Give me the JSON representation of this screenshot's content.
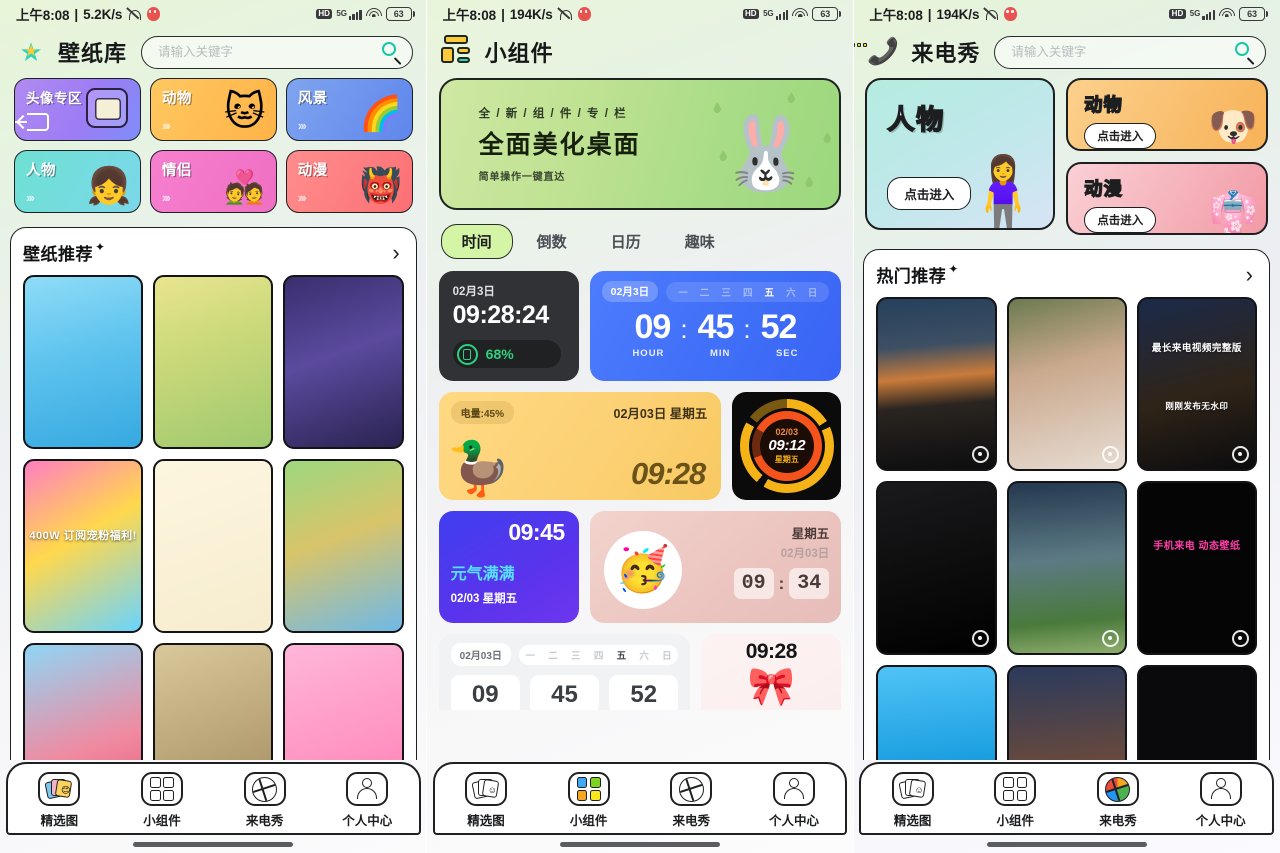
{
  "statusbar": {
    "time": "上午8:08",
    "sep": "|",
    "speed_p1": "5.2K/s",
    "speed_p2": "194K/s",
    "speed_p3": "194K/s",
    "hd_label": "HD",
    "network_label": "5G",
    "battery_level": "63",
    "icons": [
      "mute-icon",
      "qq-icon",
      "hd-icon",
      "5g-signal-icon",
      "wifi-icon",
      "battery-icon"
    ]
  },
  "panel1": {
    "app_title": "壁纸库",
    "logo_icon": "star-logo-icon",
    "search_placeholder": "请输入关键字",
    "search_value": "",
    "search_icon": "search-icon",
    "categories": [
      {
        "name": "头像专区",
        "chev": "",
        "style": "cat-avatar",
        "wide": true
      },
      {
        "name": "动物",
        "chev": "›››",
        "style": "cat-animal"
      },
      {
        "name": "风景",
        "chev": "›››",
        "style": "cat-scenery"
      },
      {
        "name": "人物",
        "chev": "›››",
        "style": "cat-person"
      },
      {
        "name": "情侣",
        "chev": "›››",
        "style": "cat-couple"
      },
      {
        "name": "动漫",
        "chev": "›››",
        "style": "cat-anime"
      }
    ],
    "section_title": "壁纸推荐",
    "section_sparkle": "✦",
    "section_arrow": "›",
    "thumbs": [
      {
        "caption": "",
        "bg": "linear-gradient(165deg,#8fdcf7,#5ec3ee 45%,#36a9e0)"
      },
      {
        "caption": "",
        "bg": "linear-gradient(160deg,#e9e58f,#cbd97a 40%,#9fc96e)"
      },
      {
        "caption": "",
        "bg": "linear-gradient(160deg,#3a2e6e,#5b4a9e 45%,#2a2350)"
      },
      {
        "caption": "400W 订阅宠粉福利!",
        "bg": "linear-gradient(150deg,#ff7ec1,#ffd84d 45%,#6ad4ff)"
      },
      {
        "caption": "",
        "bg": "linear-gradient(160deg,#fdf6e0,#f6ecce)"
      },
      {
        "caption": "",
        "bg": "linear-gradient(160deg,#9cd87f,#d8c46a 45%,#6fb9e8)"
      },
      {
        "caption": "",
        "bg": "linear-gradient(160deg,#8fd6f5,#f08aa0 60%,#e55a7a)"
      },
      {
        "caption": "",
        "bg": "linear-gradient(160deg,#d8c89a,#a38b5e)"
      },
      {
        "caption": "",
        "bg": "linear-gradient(160deg,#ffb6d9,#ff7fb3)"
      }
    ]
  },
  "panel2": {
    "app_title": "小组件",
    "logo_icon": "widget-grid-logo-icon",
    "banner": {
      "sub1": "全 / 新 / 组 / 件 / 专 / 栏",
      "big": "全面美化桌面",
      "sub2": "简单操作一键直达",
      "mascot_icon": "bunny-with-leaf-icon"
    },
    "tabs": [
      {
        "label": "时间",
        "active": true
      },
      {
        "label": "倒数",
        "active": false
      },
      {
        "label": "日历",
        "active": false
      },
      {
        "label": "趣味",
        "active": false
      }
    ],
    "widgets": {
      "dark_clock": {
        "date": "02月3日",
        "time": "09:28:24",
        "battery": "68%",
        "battery_icon": "battery-ring-icon"
      },
      "blue_counter": {
        "date": "02月3日",
        "weekdays": [
          "一",
          "二",
          "三",
          "四",
          "五",
          "六",
          "日"
        ],
        "active_day": "五",
        "hour": "09",
        "min": "45",
        "sec": "52",
        "sep": ":",
        "label_hour": "HOUR",
        "label_min": "MIN",
        "label_sec": "SEC"
      },
      "duck": {
        "battery": "电量:45%",
        "date": "02月03日 星期五",
        "time": "09:28",
        "art_icon": "duck-icon"
      },
      "ring": {
        "date": "02/03",
        "time": "09:12",
        "weekday": "星期五"
      },
      "violet": {
        "time": "09:45",
        "slogan": "元气满满",
        "date": "02/03 星期五"
      },
      "pink": {
        "weekday": "星期五",
        "date": "02月03日",
        "hh": "09",
        "mm": "34",
        "sep": ":",
        "art_icon": "party-girl-icon"
      },
      "gray_partial": {
        "date": "02月03日",
        "weekdays": [
          "一",
          "二",
          "三",
          "四",
          "五",
          "六",
          "日"
        ],
        "active_day": "五",
        "d1": "09",
        "d2": "45",
        "d3": "52"
      },
      "bow_partial": {
        "time": "09:28",
        "art_icon": "pink-bow-icon"
      }
    }
  },
  "panel3": {
    "app_title": "来电秀",
    "logo_icon": "ringing-phone-logo-icon",
    "search_placeholder": "请输入关键字",
    "search_value": "",
    "search_icon": "search-icon",
    "categories": [
      {
        "name": "人物",
        "button": "点击进入",
        "style": "person"
      },
      {
        "name": "动物",
        "button": "点击进入",
        "style": "animal"
      },
      {
        "name": "动漫",
        "button": "点击进入",
        "style": "anime"
      }
    ],
    "section_title": "热门推荐",
    "section_sparkle": "✦",
    "section_arrow": "›",
    "thumbs": [
      {
        "caption": "",
        "bg": "linear-gradient(175deg,#26405c 0%,#3d4f63 28%,#c97b3a 46%,#2a2520 62%,#0d0d0f 100%)",
        "gear": true
      },
      {
        "caption": "",
        "bg": "linear-gradient(165deg,#6b7a4e,#caa98e 40%,#e7dcd2)",
        "gear": true
      },
      {
        "caption": "最长来电视频完整版",
        "caption2": "刚刚发布无水印",
        "bg": "linear-gradient(165deg,#1b2a4a,#2f2418 55%,#0b0b0d)",
        "gear": true
      },
      {
        "caption": "",
        "bg": "linear-gradient(165deg,#1a1a1c,#000)",
        "gear": true
      },
      {
        "caption": "",
        "bg": "linear-gradient(175deg,#24384f,#5c7a84 45%,#4a7a3c 80%,#8fae6e)",
        "gear": true
      },
      {
        "caption": "手机来电 动态壁纸",
        "bg": "#050506",
        "gear": true,
        "caption_color": "#ff3fa8"
      },
      {
        "caption": "",
        "bg": "linear-gradient(175deg,#4fc3f7,#1c9fe0 55%,#0d6fa8)",
        "gear": false
      },
      {
        "caption": "",
        "bg": "linear-gradient(175deg,#2b3a5c,#6b4a3c 60%,#1a1820)",
        "gear": false
      },
      {
        "caption": "",
        "bg": "#0a0a0c",
        "gear": false
      }
    ]
  },
  "bottom_nav": {
    "items": [
      {
        "label": "精选图",
        "icon": "pictures-icon"
      },
      {
        "label": "小组件",
        "icon": "grid-widgets-icon"
      },
      {
        "label": "来电秀",
        "icon": "globe-call-icon"
      },
      {
        "label": "个人中心",
        "icon": "person-icon"
      }
    ],
    "active_panel1": 0,
    "active_panel2": 1,
    "active_panel3": 2
  }
}
